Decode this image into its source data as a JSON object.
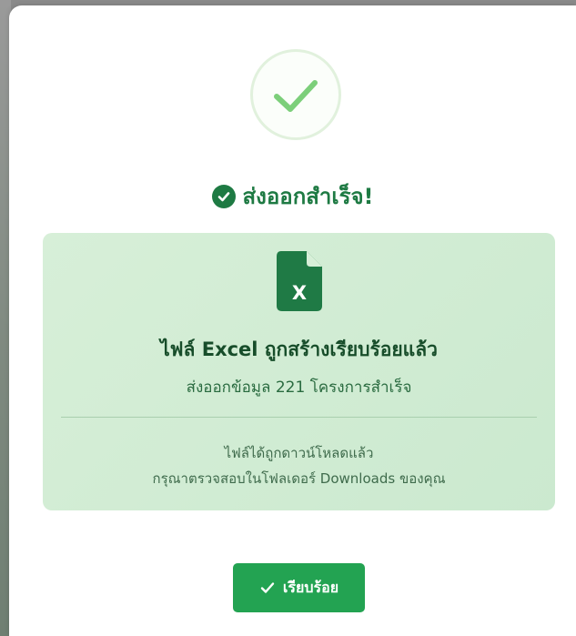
{
  "dialog": {
    "title": "ส่งออกสำเร็จ!",
    "success_icon": "check-icon",
    "title_icon": "check-circle-icon",
    "file_icon": "excel-file-icon",
    "file_icon_letter": "X",
    "file_heading": "ไฟล์ Excel ถูกสร้างเรียบร้อยแล้ว",
    "export_message": "ส่งออกข้อมูล 221 โครงการสำเร็จ",
    "download_note_line1": "ไฟล์ได้ถูกดาวน์โหลดแล้ว",
    "download_note_line2": "กรุณาตรวจสอบในโฟลเดอร์ Downloads ของคุณ",
    "button_label": "เรียบร้อย",
    "button_icon": "check-icon"
  },
  "colors": {
    "accent": "#23a352",
    "title": "#1e7a43",
    "file_icon": "#1f7a45",
    "box_background": "#d7efd8"
  }
}
